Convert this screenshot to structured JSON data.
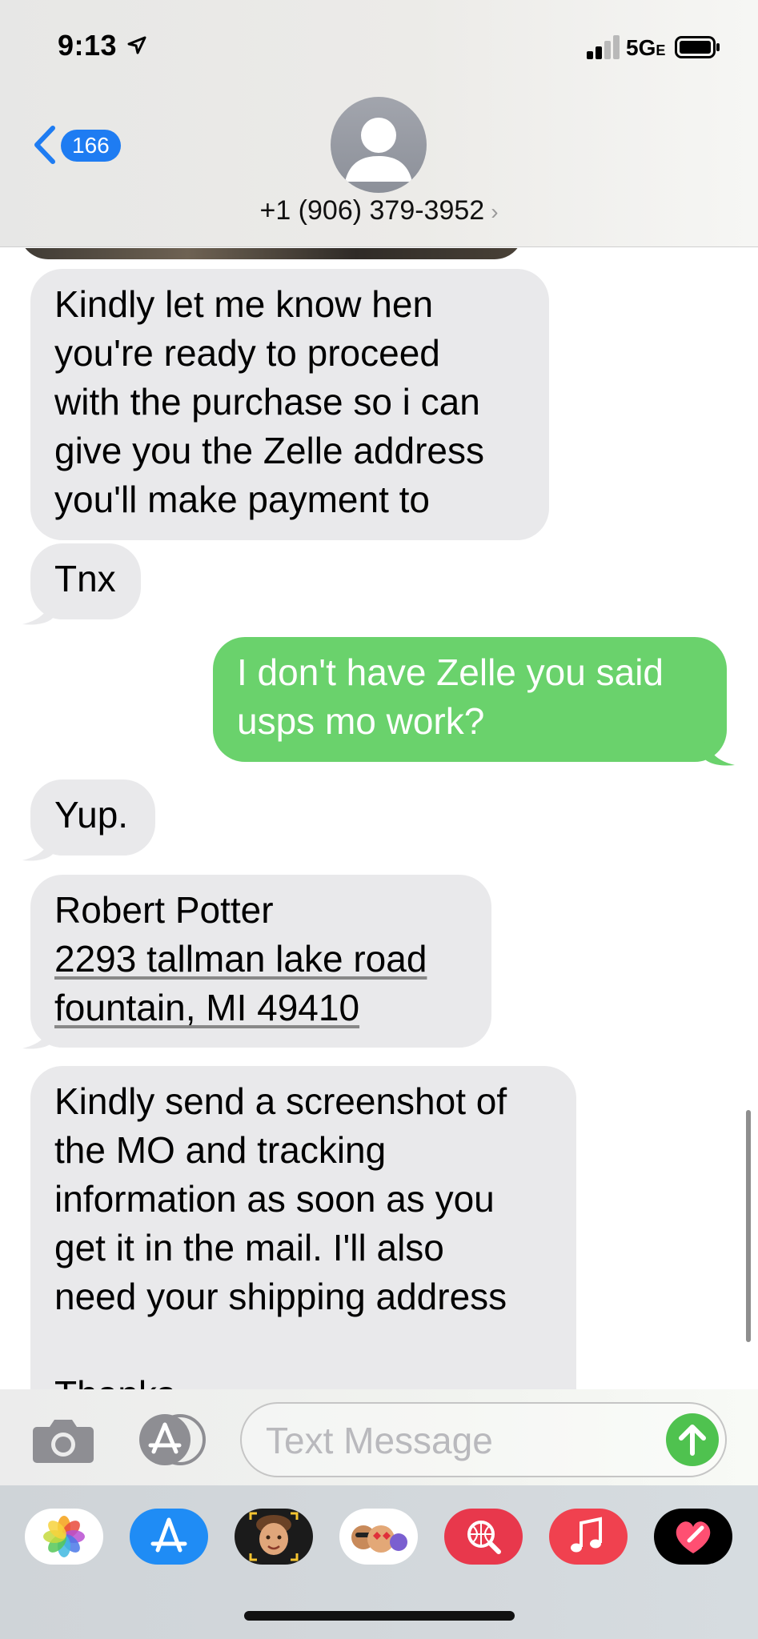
{
  "status_bar": {
    "time": "9:13",
    "network": "5G",
    "network_suffix": "E"
  },
  "header": {
    "back_count": "166",
    "contact": "+1 (906) 379-3952",
    "contact_chevron": "›"
  },
  "messages": [
    {
      "direction": "incoming",
      "lines": [
        "Kindly let me know hen",
        "you're ready to proceed",
        "with the purchase so i can",
        "give you the Zelle address",
        "you'll make payment to"
      ]
    },
    {
      "direction": "incoming",
      "lines": [
        "Tnx"
      ]
    },
    {
      "direction": "outgoing",
      "lines": [
        "I don't have Zelle you said",
        "usps mo work?"
      ]
    },
    {
      "direction": "incoming",
      "lines": [
        "Yup."
      ]
    },
    {
      "direction": "incoming",
      "lines": [
        "Robert Potter",
        "2293 tallman lake road",
        "fountain, MI 49410"
      ]
    },
    {
      "direction": "incoming",
      "lines": [
        "Kindly send a screenshot of",
        "the MO and tracking",
        "information as soon as you",
        "get it in the mail. I'll also",
        "need your shipping address",
        "",
        "Thanks"
      ]
    }
  ],
  "input": {
    "placeholder": "Text Message"
  },
  "app_drawer": {
    "apps": [
      "photos-icon",
      "app-store-icon",
      "memoji-icon",
      "animoji-stickers-icon",
      "web-image-search-icon",
      "music-icon",
      "digital-touch-icon"
    ]
  },
  "colors": {
    "outgoing_bubble": "#6ad26c",
    "incoming_bubble": "#e9e9eb",
    "accent_blue": "#1e7cf2",
    "send_button": "#4fc24f"
  }
}
